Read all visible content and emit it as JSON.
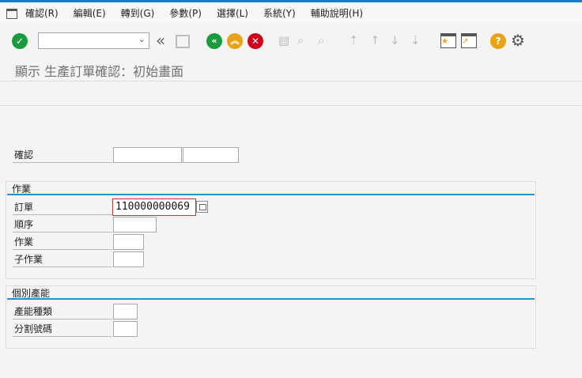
{
  "menu": {
    "items": [
      "確認(R)",
      "編輯(E)",
      "轉到(G)",
      "參數(P)",
      "選擇(L)",
      "系統(Y)",
      "輔助說明(H)"
    ]
  },
  "toolbar": {
    "command_field_value": "",
    "icons": [
      "enter-check-icon",
      "double-chevron-left-icon",
      "save-icon",
      "back-icon",
      "exit-icon",
      "cancel-icon",
      "print-icon",
      "find-icon",
      "find-next-icon",
      "first-page-icon",
      "previous-page-icon",
      "next-page-icon",
      "last-page-icon",
      "create-session-icon",
      "create-shortcut-icon",
      "help-icon",
      "customize-layout-icon"
    ],
    "colors": {
      "enter": "#1a9c3e",
      "back": "#1a9c3e",
      "exit": "#e8a317",
      "cancel": "#d0021b",
      "help": "#e8a317"
    }
  },
  "title": "顯示 生產訂單確認：初始畫面",
  "form": {
    "confirmation_label": "確認",
    "confirmation_value_1": "",
    "confirmation_value_2": "",
    "operation_group": {
      "title": "作業",
      "order_label": "訂單",
      "order_value": "110000000069",
      "sequence_label": "順序",
      "sequence_value": "",
      "activity_label": "作業",
      "activity_value": "",
      "sub_activity_label": "子作業",
      "sub_activity_value": ""
    },
    "capacity_group": {
      "title": "個別產能",
      "capacity_category_label": "產能種類",
      "capacity_category_value": "",
      "split_number_label": "分割號碼",
      "split_number_value": ""
    }
  }
}
